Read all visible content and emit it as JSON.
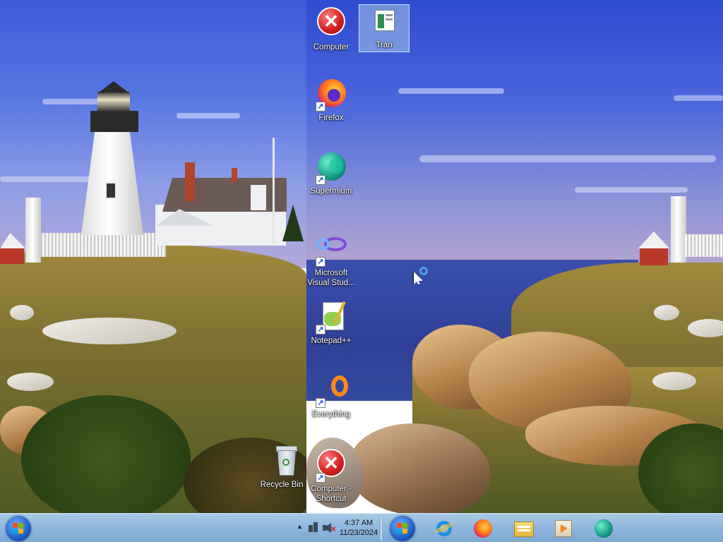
{
  "desktop_icons": {
    "computer": "Computer",
    "tran": "Tran",
    "firefox": "Firefox",
    "supermium": "Supermium",
    "visual_studio": "Microsoft Visual Stud...",
    "notepad": "Notepad++",
    "everything": "Everything",
    "computer_shortcut": "Computer - Shortcut",
    "recycle_bin": "Recycle Bin"
  },
  "taskbar": {
    "clock_time": "4:37 AM",
    "clock_date": "11/23/2024",
    "tray_arrow": "▲",
    "pinned": [
      "Internet Explorer",
      "Firefox",
      "File Explorer",
      "Media Player",
      "Supermium"
    ]
  },
  "colors": {
    "taskbar": "#8fb6dc",
    "sky": "#4f6ee0",
    "error_red": "#d11f1f"
  }
}
